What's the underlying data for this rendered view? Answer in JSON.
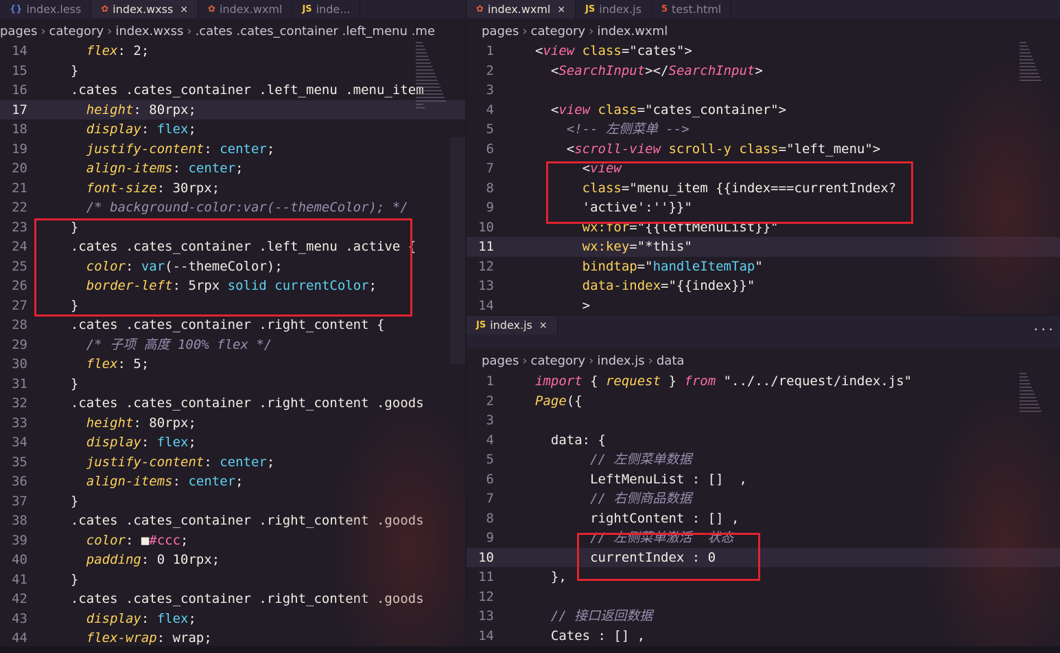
{
  "left": {
    "tabs": [
      {
        "icon": "less",
        "label": "index.less",
        "active": false
      },
      {
        "icon": "wx",
        "label": "index.wxss",
        "active": true
      },
      {
        "icon": "wx",
        "label": "index.wxml",
        "active": false
      },
      {
        "icon": "js",
        "label": "inde...",
        "active": false
      }
    ],
    "crumbs": [
      "pages",
      "category",
      "index.wxss",
      ".cates .cates_container .left_menu .me"
    ],
    "lines": [
      {
        "no": "14",
        "code": [
          [
            "p",
            "    flex"
          ],
          [
            "w",
            ": 2;"
          ]
        ]
      },
      {
        "no": "15",
        "code": [
          [
            "w",
            "  }"
          ]
        ]
      },
      {
        "no": "16",
        "code": [
          [
            "w",
            "  .cates .cates_container .left_menu .menu_item"
          ]
        ]
      },
      {
        "no": "17",
        "cur": true,
        "code": [
          [
            "p",
            "    height"
          ],
          [
            "w",
            ": 80rpx;"
          ]
        ]
      },
      {
        "no": "18",
        "code": [
          [
            "p",
            "    display"
          ],
          [
            "w",
            ": "
          ],
          [
            "v",
            "flex"
          ],
          [
            "w",
            ";"
          ]
        ]
      },
      {
        "no": "19",
        "code": [
          [
            "p",
            "    justify-content"
          ],
          [
            "w",
            ": "
          ],
          [
            "v",
            "center"
          ],
          [
            "w",
            ";"
          ]
        ]
      },
      {
        "no": "20",
        "code": [
          [
            "p",
            "    align-items"
          ],
          [
            "w",
            ": "
          ],
          [
            "v",
            "center"
          ],
          [
            "w",
            ";"
          ]
        ]
      },
      {
        "no": "21",
        "code": [
          [
            "p",
            "    font-size"
          ],
          [
            "w",
            ": 30rpx;"
          ]
        ]
      },
      {
        "no": "22",
        "code": [
          [
            "c",
            "    /* background-color:var(--themeColor); */"
          ]
        ]
      },
      {
        "no": "23",
        "code": [
          [
            "w",
            "  }"
          ]
        ]
      },
      {
        "no": "24",
        "code": [
          [
            "w",
            "  .cates .cates_container .left_menu .active {"
          ]
        ]
      },
      {
        "no": "25",
        "code": [
          [
            "p",
            "    color"
          ],
          [
            "w",
            ": "
          ],
          [
            "v",
            "var"
          ],
          [
            "w",
            "(--themeColor);"
          ]
        ]
      },
      {
        "no": "26",
        "code": [
          [
            "p",
            "    border-left"
          ],
          [
            "w",
            ": 5rpx "
          ],
          [
            "v",
            "solid currentColor"
          ],
          [
            "w",
            ";"
          ]
        ]
      },
      {
        "no": "27",
        "code": [
          [
            "w",
            "  }"
          ]
        ]
      },
      {
        "no": "28",
        "code": [
          [
            "w",
            "  .cates .cates_container .right_content {"
          ]
        ]
      },
      {
        "no": "29",
        "code": [
          [
            "c",
            "    /* 子项 高度 100% flex */"
          ]
        ]
      },
      {
        "no": "30",
        "code": [
          [
            "p",
            "    flex"
          ],
          [
            "w",
            ": 5;"
          ]
        ]
      },
      {
        "no": "31",
        "code": [
          [
            "w",
            "  }"
          ]
        ]
      },
      {
        "no": "32",
        "code": [
          [
            "w",
            "  .cates .cates_container .right_content .goods"
          ]
        ]
      },
      {
        "no": "33",
        "code": [
          [
            "p",
            "    height"
          ],
          [
            "w",
            ": 80rpx;"
          ]
        ]
      },
      {
        "no": "34",
        "code": [
          [
            "p",
            "    display"
          ],
          [
            "w",
            ": "
          ],
          [
            "v",
            "flex"
          ],
          [
            "w",
            ";"
          ]
        ]
      },
      {
        "no": "35",
        "code": [
          [
            "p",
            "    justify-content"
          ],
          [
            "w",
            ": "
          ],
          [
            "v",
            "center"
          ],
          [
            "w",
            ";"
          ]
        ]
      },
      {
        "no": "36",
        "code": [
          [
            "p",
            "    align-items"
          ],
          [
            "w",
            ": "
          ],
          [
            "v",
            "center"
          ],
          [
            "w",
            ";"
          ]
        ]
      },
      {
        "no": "37",
        "code": [
          [
            "w",
            "  }"
          ]
        ]
      },
      {
        "no": "38",
        "code": [
          [
            "w",
            "  .cates .cates_container .right_content .goods"
          ]
        ]
      },
      {
        "no": "39",
        "code": [
          [
            "p",
            "    color"
          ],
          [
            "w",
            ": ■"
          ],
          [
            "n",
            "#ccc"
          ],
          [
            "w",
            ";"
          ]
        ]
      },
      {
        "no": "40",
        "code": [
          [
            "p",
            "    padding"
          ],
          [
            "w",
            ": 0 10rpx;"
          ]
        ]
      },
      {
        "no": "41",
        "code": [
          [
            "w",
            "  }"
          ]
        ]
      },
      {
        "no": "42",
        "code": [
          [
            "w",
            "  .cates .cates_container .right_content .goods"
          ]
        ]
      },
      {
        "no": "43",
        "code": [
          [
            "p",
            "    display"
          ],
          [
            "w",
            ": "
          ],
          [
            "v",
            "flex"
          ],
          [
            "w",
            ";"
          ]
        ]
      },
      {
        "no": "44",
        "code": [
          [
            "p",
            "    flex-wrap"
          ],
          [
            "w",
            ": wrap;"
          ]
        ]
      }
    ]
  },
  "topright": {
    "tabs": [
      {
        "icon": "wx",
        "label": "index.wxml",
        "active": true
      },
      {
        "icon": "js",
        "label": "index.js",
        "active": false
      },
      {
        "icon": "html",
        "label": "test.html",
        "active": false
      }
    ],
    "crumbs": [
      "pages",
      "category",
      "index.wxml"
    ],
    "lines": [
      {
        "no": "1",
        "code": [
          [
            "w",
            "<"
          ],
          [
            "t",
            "view"
          ],
          [
            "a",
            " class"
          ],
          [
            "w",
            "=\"cates\">"
          ]
        ]
      },
      {
        "no": "2",
        "code": [
          [
            "w",
            "  <"
          ],
          [
            "t",
            "SearchInput"
          ],
          [
            "w",
            "></"
          ],
          [
            "t",
            "SearchInput"
          ],
          [
            "w",
            ">"
          ]
        ]
      },
      {
        "no": "3",
        "code": [
          [
            "w",
            ""
          ]
        ]
      },
      {
        "no": "4",
        "code": [
          [
            "w",
            "  <"
          ],
          [
            "t",
            "view"
          ],
          [
            "a",
            " class"
          ],
          [
            "w",
            "=\"cates_container\">"
          ]
        ]
      },
      {
        "no": "5",
        "code": [
          [
            "c",
            "    <!-- 左侧菜单 -->"
          ]
        ]
      },
      {
        "no": "6",
        "code": [
          [
            "w",
            "    <"
          ],
          [
            "t",
            "scroll-view"
          ],
          [
            "a",
            " scroll-y class"
          ],
          [
            "w",
            "=\"left_menu\">"
          ]
        ]
      },
      {
        "no": "7",
        "code": [
          [
            "w",
            "      <"
          ],
          [
            "t",
            "view"
          ]
        ]
      },
      {
        "no": "8",
        "code": [
          [
            "a",
            "      class"
          ],
          [
            "w",
            "=\"menu_item {{index===currentIndex?"
          ]
        ]
      },
      {
        "no": "9",
        "code": [
          [
            "w",
            "      'active':''}}\""
          ]
        ]
      },
      {
        "no": "10",
        "code": [
          [
            "a",
            "      wx:for"
          ],
          [
            "w",
            "=\"{{leftMenuList}}\""
          ]
        ]
      },
      {
        "no": "11",
        "cur": true,
        "code": [
          [
            "a",
            "      wx:key"
          ],
          [
            "w",
            "=\"*this\""
          ]
        ]
      },
      {
        "no": "12",
        "code": [
          [
            "a",
            "      bindtap"
          ],
          [
            "w",
            "=\""
          ],
          [
            "v",
            "handleItemTap"
          ],
          [
            "w",
            "\""
          ]
        ]
      },
      {
        "no": "13",
        "code": [
          [
            "a",
            "      data-index"
          ],
          [
            "w",
            "=\"{{index}}\""
          ]
        ]
      },
      {
        "no": "14",
        "code": [
          [
            "w",
            "      >"
          ]
        ]
      }
    ]
  },
  "bottomright": {
    "tabs": [
      {
        "icon": "js",
        "label": "index.js",
        "active": true
      }
    ],
    "more": "···",
    "crumbs": [
      "pages",
      "category",
      "index.js",
      "data"
    ],
    "lines": [
      {
        "no": "1",
        "code": [
          [
            "k",
            "import"
          ],
          [
            "w",
            " { "
          ],
          [
            "p",
            "request"
          ],
          [
            "w",
            " } "
          ],
          [
            "k",
            "from"
          ],
          [
            "w",
            " \"../../request/index.js\""
          ]
        ]
      },
      {
        "no": "2",
        "code": [
          [
            "p",
            "Page"
          ],
          [
            "w",
            "({"
          ]
        ]
      },
      {
        "no": "3",
        "code": [
          [
            "w",
            ""
          ]
        ]
      },
      {
        "no": "4",
        "code": [
          [
            "w",
            "  data: {"
          ]
        ]
      },
      {
        "no": "5",
        "code": [
          [
            "c",
            "       // 左侧菜单数据"
          ]
        ]
      },
      {
        "no": "6",
        "code": [
          [
            "w",
            "       LeftMenuList : []  ,"
          ]
        ]
      },
      {
        "no": "7",
        "code": [
          [
            "c",
            "       // 右侧商品数据"
          ]
        ]
      },
      {
        "no": "8",
        "code": [
          [
            "w",
            "       rightContent : [] ,"
          ]
        ]
      },
      {
        "no": "9",
        "code": [
          [
            "c",
            "       // 左侧菜单激活  状态"
          ]
        ]
      },
      {
        "no": "10",
        "cur": true,
        "code": [
          [
            "w",
            "       currentIndex : 0"
          ]
        ]
      },
      {
        "no": "11",
        "code": [
          [
            "w",
            "  },"
          ]
        ]
      },
      {
        "no": "12",
        "code": [
          [
            "w",
            ""
          ]
        ]
      },
      {
        "no": "13",
        "code": [
          [
            "c",
            "  // 接口返回数据"
          ]
        ]
      },
      {
        "no": "14",
        "code": [
          [
            "w",
            "  Cates : [] ,"
          ]
        ]
      }
    ]
  }
}
